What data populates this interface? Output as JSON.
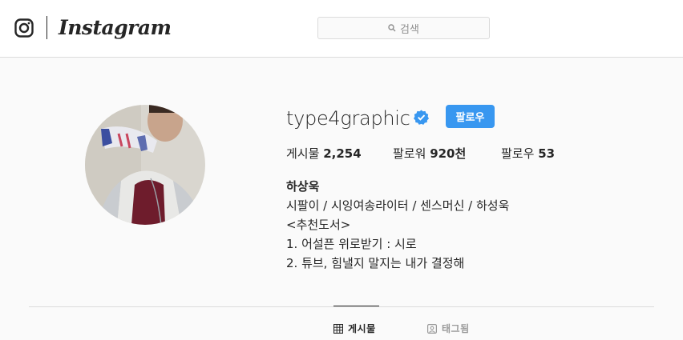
{
  "header": {
    "brand": "Instagram",
    "search_placeholder": "검색"
  },
  "profile": {
    "username": "type4graphic",
    "verified": true,
    "follow_label": "팔로우",
    "stats": {
      "posts_label": "게시물",
      "posts_value": "2,254",
      "followers_label": "팔로워",
      "followers_value": "920천",
      "following_label": "팔로우",
      "following_value": "53"
    },
    "bio": {
      "name": "하상욱",
      "line1": "시팔이 / 시잉여송라이터 / 센스머신 / 하성욱",
      "line2": "<추천도서>",
      "line3": "1. 어설픈 위로받기 : 시로",
      "line4": "2. 튜브, 힘낼지 말지는 내가 결정해"
    }
  },
  "tabs": [
    {
      "label": "게시물",
      "icon": "grid-icon",
      "active": true
    },
    {
      "label": "태그됨",
      "icon": "tagged-icon",
      "active": false
    }
  ],
  "colors": {
    "accent": "#3897f0",
    "text": "#262626",
    "muted": "#8e8e8e",
    "border": "#dbdbdb",
    "background": "#fafafa"
  }
}
